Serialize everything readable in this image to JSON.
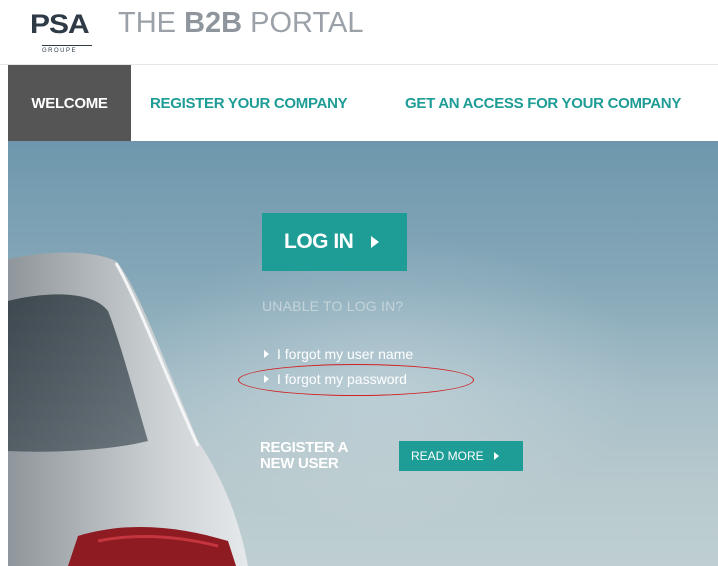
{
  "header": {
    "logo_main": "PSA",
    "logo_sub": "GROUPE",
    "title_prefix": "THE ",
    "title_bold": "B2B",
    "title_suffix": " PORTAL"
  },
  "nav": {
    "items": [
      {
        "label": "WELCOME",
        "active": true
      },
      {
        "label": "REGISTER YOUR COMPANY",
        "active": false
      },
      {
        "label": "GET AN ACCESS FOR YOUR COMPANY",
        "active": false
      }
    ]
  },
  "hero": {
    "login_label": "LOG IN",
    "unable_text": "UNABLE TO LOG IN?",
    "links": [
      {
        "label": "I forgot my user name"
      },
      {
        "label": "I forgot my password"
      }
    ],
    "register_line1": "REGISTER A",
    "register_line2": "NEW USER",
    "read_more_label": "READ MORE"
  },
  "colors": {
    "accent": "#1e9c96",
    "nav_active_bg": "#555555",
    "highlight": "#d02020"
  },
  "icons": {
    "login_arrow": "chevron-right-icon",
    "link_bullet": "triangle-right-icon",
    "read_more_arrow": "chevron-right-icon"
  }
}
